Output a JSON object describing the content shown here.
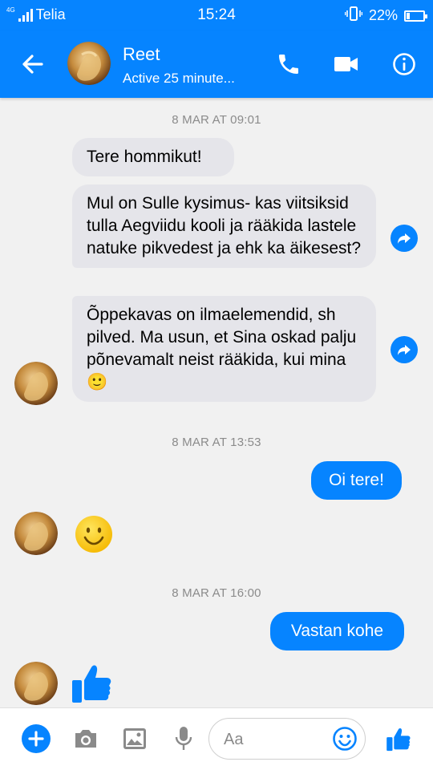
{
  "status_bar": {
    "network_type": "4G",
    "carrier": "Telia",
    "time": "15:24",
    "battery_percent": "22%",
    "battery_level": 0.22
  },
  "header": {
    "contact_name": "Reet",
    "contact_status": "Active 25 minute...",
    "accent_color": "#0684ff"
  },
  "conversation": {
    "timestamps": [
      "8 MAR AT 09:01",
      "8 MAR AT 13:53",
      "8 MAR AT 16:00"
    ],
    "messages": [
      {
        "direction": "incoming",
        "text": "Tere hommikut!"
      },
      {
        "direction": "incoming",
        "text": "Mul on Sulle kysimus- kas viitsiksid tulla Aegviidu kooli ja rääkida lastele natuke pikvedest ja ehk ka äikesest?"
      },
      {
        "direction": "incoming",
        "text": "Õppekavas on ilmaelemendid, sh pilved. Ma usun, et Sina oskad palju põnevamalt neist rääkida, kui mina 🙂"
      },
      {
        "direction": "outgoing",
        "text": "Oi tere!"
      },
      {
        "direction": "incoming",
        "type": "emoji",
        "icon": "smiley-emoji-icon"
      },
      {
        "direction": "outgoing",
        "text": "Vastan kohe"
      },
      {
        "direction": "incoming",
        "type": "like",
        "icon": "thumbs-up-icon"
      }
    ]
  },
  "composer": {
    "placeholder": "Aa",
    "value": ""
  }
}
